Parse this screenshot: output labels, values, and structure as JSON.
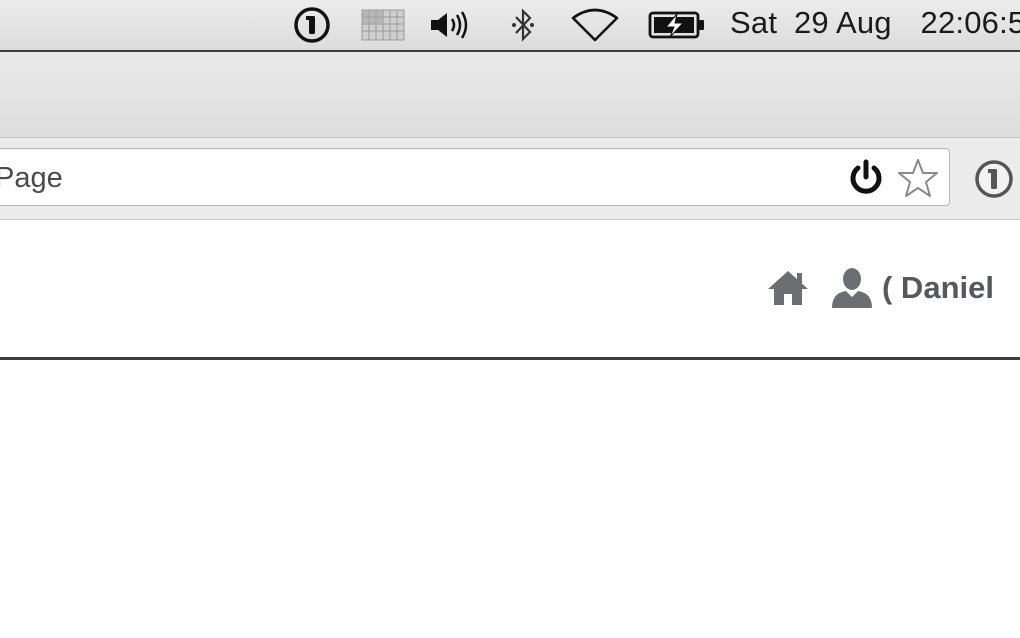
{
  "menubar": {
    "icons": [
      {
        "name": "1password-icon"
      },
      {
        "name": "grid-app-icon"
      },
      {
        "name": "volume-icon"
      },
      {
        "name": "bluetooth-icon"
      },
      {
        "name": "wifi-icon"
      },
      {
        "name": "battery-charging-icon"
      }
    ],
    "clock": {
      "day": "Sat",
      "date": "29 Aug",
      "time": "22:06:5"
    }
  },
  "toolbar": {
    "address_text": "Page",
    "omnibox_icons": [
      "power-icon",
      "bookmark-star-icon"
    ],
    "extension_icon": "1password-extension-icon"
  },
  "page_header": {
    "home_icon": "home-icon",
    "user_icon": "user-icon",
    "user_label": "( Daniel"
  },
  "colors": {
    "menubar_text": "#1a1a1a",
    "header_divider": "#3b3f44",
    "nav_icon": "#6b6f74",
    "user_text": "#55595e"
  }
}
